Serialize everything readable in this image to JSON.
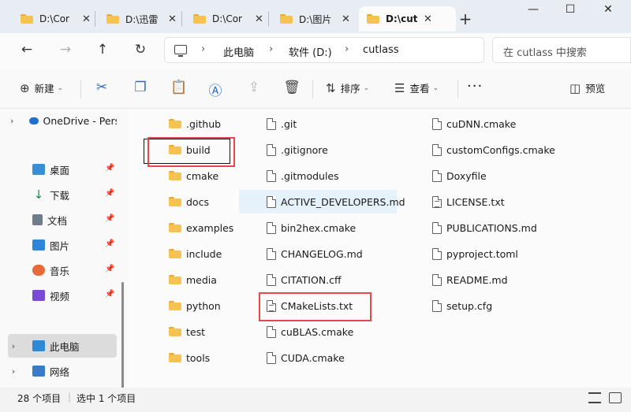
{
  "tabs": [
    {
      "label": "D:\\Cor",
      "active": false
    },
    {
      "label": "D:\\迅雷",
      "active": false
    },
    {
      "label": "D:\\Cor",
      "active": false
    },
    {
      "label": "D:\\图片",
      "active": false
    },
    {
      "label": "D:\\cut",
      "active": true
    }
  ],
  "tab_close_glyph": "✕",
  "new_tab_glyph": "+",
  "window": {
    "minimize": "—",
    "maximize": "☐",
    "close": "✕"
  },
  "address": {
    "crumbs": [
      "此电脑",
      "软件 (D:)",
      "cutlass"
    ],
    "separator": "›"
  },
  "search": {
    "placeholder": "在 cutlass 中搜索"
  },
  "toolbar": {
    "new_label": "新建",
    "sort_label": "排序",
    "view_label": "查看",
    "more_label": "···",
    "preview_label": "预览"
  },
  "sidebar": {
    "items": [
      {
        "label": "OneDrive - Personal",
        "icon": "cloud-icon",
        "color": "#1e6fd1"
      },
      {
        "label": "桌面",
        "icon": "desktop-icon",
        "color": "#3a8ed6",
        "pinned": true
      },
      {
        "label": "下载",
        "icon": "download-icon",
        "color": "#1b8a4f",
        "pinned": true
      },
      {
        "label": "文档",
        "icon": "document-icon",
        "color": "#6f7c8c",
        "pinned": true
      },
      {
        "label": "图片",
        "icon": "picture-icon",
        "color": "#2f86d8",
        "pinned": true
      },
      {
        "label": "音乐",
        "icon": "music-icon",
        "color": "#e56b3a",
        "pinned": true
      },
      {
        "label": "视频",
        "icon": "video-icon",
        "color": "#7b4bd6",
        "pinned": true
      },
      {
        "label": "此电脑",
        "icon": "computer-icon",
        "color": "#2d89d4",
        "selected": true
      },
      {
        "label": "网络",
        "icon": "network-icon",
        "color": "#3a7bc8"
      }
    ],
    "pin_glyph": "📌",
    "chevron_glyph": "›"
  },
  "files": {
    "col1": [
      ".github",
      "build",
      "cmake",
      "docs",
      "examples",
      "include",
      "media",
      "python",
      "test",
      "tools"
    ],
    "col2": [
      ".git",
      ".gitignore",
      ".gitmodules",
      "ACTIVE_DEVELOPERS.md",
      "bin2hex.cmake",
      "CHANGELOG.md",
      "CITATION.cff",
      "CMakeLists.txt",
      "cuBLAS.cmake",
      "CUDA.cmake"
    ],
    "col3": [
      "cuDNN.cmake",
      "customConfigs.cmake",
      "Doxyfile",
      "LICENSE.txt",
      "PUBLICATIONS.md",
      "pyproject.toml",
      "README.md",
      "setup.cfg"
    ]
  },
  "status": {
    "count": "28 个项目",
    "selected": "选中 1 个项目"
  },
  "colors": {
    "accent": "#2c6bc5",
    "highlight": "#e8474d",
    "folder": "#f6c353"
  }
}
